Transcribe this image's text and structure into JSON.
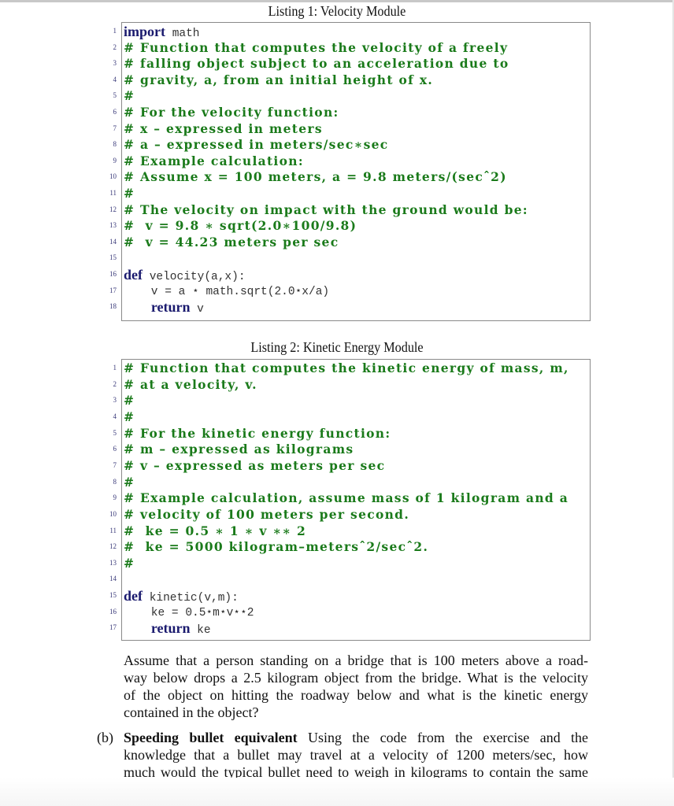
{
  "listing1": {
    "caption": "Listing 1: Velocity Module",
    "lines": [
      {
        "n": "1",
        "parts": [
          {
            "t": "kw",
            "s": "import"
          },
          {
            "t": "tt",
            "s": " math"
          }
        ]
      },
      {
        "n": "2",
        "parts": [
          {
            "t": "cmt",
            "s": "# Function that computes the velocity of a freely"
          }
        ]
      },
      {
        "n": "3",
        "parts": [
          {
            "t": "cmt",
            "s": "# falling object subject to an acceleration due to"
          }
        ]
      },
      {
        "n": "4",
        "parts": [
          {
            "t": "cmt",
            "s": "# gravity, a, from an initial height of x."
          }
        ]
      },
      {
        "n": "5",
        "parts": [
          {
            "t": "cmt",
            "s": "#"
          }
        ]
      },
      {
        "n": "6",
        "parts": [
          {
            "t": "cmt",
            "s": "# For the velocity function:"
          }
        ]
      },
      {
        "n": "7",
        "parts": [
          {
            "t": "cmt",
            "s": "# x – expressed in meters"
          }
        ]
      },
      {
        "n": "8",
        "parts": [
          {
            "t": "cmt",
            "s": "# a – expressed in meters/sec∗sec"
          }
        ]
      },
      {
        "n": "9",
        "parts": [
          {
            "t": "cmt",
            "s": "# Example calculation:"
          }
        ]
      },
      {
        "n": "10",
        "parts": [
          {
            "t": "cmt",
            "s": "# Assume x = 100 meters, a = 9.8 meters/(secˆ2)"
          }
        ]
      },
      {
        "n": "11",
        "parts": [
          {
            "t": "cmt",
            "s": "#"
          }
        ]
      },
      {
        "n": "12",
        "parts": [
          {
            "t": "cmt",
            "s": "# The velocity on impact with the ground would be:"
          }
        ]
      },
      {
        "n": "13",
        "parts": [
          {
            "t": "cmt",
            "s": "#  v = 9.8 ∗ sqrt(2.0∗100/9.8)"
          }
        ]
      },
      {
        "n": "14",
        "parts": [
          {
            "t": "cmt",
            "s": "#  v = 44.23 meters per sec"
          }
        ]
      },
      {
        "n": "15",
        "parts": []
      },
      {
        "n": "16",
        "parts": [
          {
            "t": "kw",
            "s": "def"
          },
          {
            "t": "tt",
            "s": " velocity(a,x):"
          }
        ]
      },
      {
        "n": "17",
        "parts": [
          {
            "t": "tt",
            "s": "    v = a ⋆ math.sqrt(2.0⋆x/a)"
          }
        ]
      },
      {
        "n": "18",
        "parts": [
          {
            "t": "tt",
            "s": "    "
          },
          {
            "t": "kw",
            "s": "return"
          },
          {
            "t": "tt",
            "s": " v"
          }
        ]
      }
    ]
  },
  "listing2": {
    "caption": "Listing 2: Kinetic Energy Module",
    "lines": [
      {
        "n": "1",
        "parts": [
          {
            "t": "cmt",
            "s": "# Function that computes the kinetic energy of mass, m,"
          }
        ]
      },
      {
        "n": "2",
        "parts": [
          {
            "t": "cmt",
            "s": "# at a velocity, v."
          }
        ]
      },
      {
        "n": "3",
        "parts": [
          {
            "t": "cmt",
            "s": "#"
          }
        ]
      },
      {
        "n": "4",
        "parts": [
          {
            "t": "cmt",
            "s": "#"
          }
        ]
      },
      {
        "n": "5",
        "parts": [
          {
            "t": "cmt",
            "s": "# For the kinetic energy function:"
          }
        ]
      },
      {
        "n": "6",
        "parts": [
          {
            "t": "cmt",
            "s": "# m – expressed as kilograms"
          }
        ]
      },
      {
        "n": "7",
        "parts": [
          {
            "t": "cmt",
            "s": "# v – expressed as meters per sec"
          }
        ]
      },
      {
        "n": "8",
        "parts": [
          {
            "t": "cmt",
            "s": "#"
          }
        ]
      },
      {
        "n": "9",
        "parts": [
          {
            "t": "cmt",
            "s": "# Example calculation, assume mass of 1 kilogram and a"
          }
        ]
      },
      {
        "n": "10",
        "parts": [
          {
            "t": "cmt",
            "s": "# velocity of 100 meters per second."
          }
        ]
      },
      {
        "n": "11",
        "parts": [
          {
            "t": "cmt",
            "s": "#  ke = 0.5 ∗ 1 ∗ v ∗∗ 2"
          }
        ]
      },
      {
        "n": "12",
        "parts": [
          {
            "t": "cmt",
            "s": "#  ke = 5000 kilogram–metersˆ2/secˆ2."
          }
        ]
      },
      {
        "n": "13",
        "parts": [
          {
            "t": "cmt",
            "s": "#"
          }
        ]
      },
      {
        "n": "14",
        "parts": []
      },
      {
        "n": "15",
        "parts": [
          {
            "t": "kw",
            "s": "def"
          },
          {
            "t": "tt",
            "s": " kinetic(v,m):"
          }
        ]
      },
      {
        "n": "16",
        "parts": [
          {
            "t": "tt",
            "s": "    ke = 0.5⋆m⋆v⋆⋆2"
          }
        ]
      },
      {
        "n": "17",
        "parts": [
          {
            "t": "tt",
            "s": "    "
          },
          {
            "t": "kw",
            "s": "return"
          },
          {
            "t": "tt",
            "s": " ke"
          }
        ]
      }
    ]
  },
  "question": {
    "lines": [
      "Assume that a person standing on a bridge that is 100 meters above a road-",
      "way below drops a 2.5 kilogram object from the bridge. What is the velocity",
      "of the object on hitting the roadway below and what is the kinetic energy",
      "contained in the object?"
    ]
  },
  "part_b": {
    "label": "(b)",
    "title": "Speeding bullet equivalent",
    "first_line_rest": "Using the code from the exercise and the",
    "lines": [
      "knowledge that a bullet may travel at a velocity of 1200 meters/sec, how",
      "much would the typical bullet need to weigh in kilograms to contain the same"
    ]
  }
}
